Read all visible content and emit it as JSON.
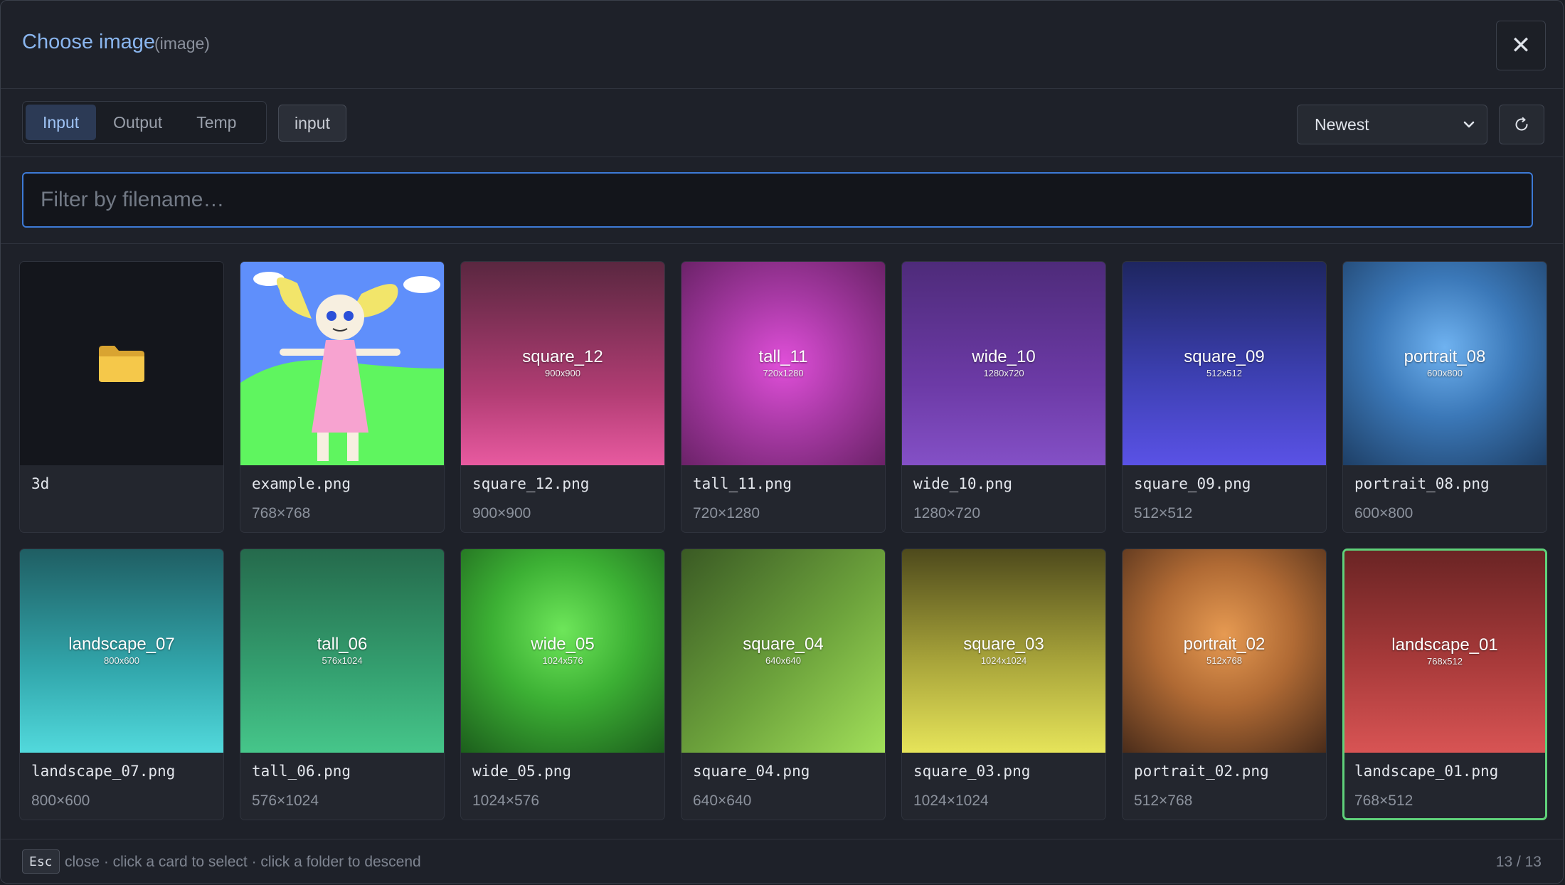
{
  "header": {
    "title": "Choose image",
    "subtitle": "(image)",
    "close_label": "✕"
  },
  "toolbar": {
    "tabs": [
      {
        "label": "Input",
        "active": true
      },
      {
        "label": "Output",
        "active": false
      },
      {
        "label": "Temp",
        "active": false
      }
    ],
    "path_chip": "input",
    "sort": {
      "value": "Newest"
    },
    "refresh_icon": "refresh-icon"
  },
  "filter": {
    "placeholder": "Filter by filename…",
    "value": ""
  },
  "items": [
    {
      "kind": "folder",
      "name": "3d",
      "dims": "",
      "thumb_label": "",
      "thumb_dims": "",
      "icon": "folder-icon"
    },
    {
      "kind": "image",
      "name": "example.png",
      "dims": "768×768",
      "thumb_label": "",
      "thumb_dims": ""
    },
    {
      "kind": "image",
      "name": "square_12.png",
      "dims": "900×900",
      "thumb_label": "square_12",
      "thumb_dims": "900x900",
      "color": "#b23d74"
    },
    {
      "kind": "image",
      "name": "tall_11.png",
      "dims": "720×1280",
      "thumb_label": "tall_11",
      "thumb_dims": "720x1280",
      "color": "#a93aa6"
    },
    {
      "kind": "image",
      "name": "wide_10.png",
      "dims": "1280×720",
      "thumb_label": "wide_10",
      "thumb_dims": "1280x720",
      "color": "#6c3aa6"
    },
    {
      "kind": "image",
      "name": "square_09.png",
      "dims": "512×512",
      "thumb_label": "square_09",
      "thumb_dims": "512x512",
      "color": "#3c3fb0"
    },
    {
      "kind": "image",
      "name": "portrait_08.png",
      "dims": "600×800",
      "thumb_label": "portrait_08",
      "thumb_dims": "600x800",
      "color": "#3b78b8"
    },
    {
      "kind": "image",
      "name": "landscape_07.png",
      "dims": "800×600",
      "thumb_label": "landscape_07",
      "thumb_dims": "800x600",
      "color": "#32a8ad"
    },
    {
      "kind": "image",
      "name": "tall_06.png",
      "dims": "576×1024",
      "thumb_label": "tall_06",
      "thumb_dims": "576x1024",
      "color": "#34a070"
    },
    {
      "kind": "image",
      "name": "wide_05.png",
      "dims": "1024×576",
      "thumb_label": "wide_05",
      "thumb_dims": "1024x576",
      "color": "#3cb034"
    },
    {
      "kind": "image",
      "name": "square_04.png",
      "dims": "640×640",
      "thumb_label": "square_04",
      "thumb_dims": "640x640",
      "color": "#6da33c"
    },
    {
      "kind": "image",
      "name": "square_03.png",
      "dims": "1024×1024",
      "thumb_label": "square_03",
      "thumb_dims": "1024x1024",
      "color": "#a8a43a"
    },
    {
      "kind": "image",
      "name": "portrait_02.png",
      "dims": "512×768",
      "thumb_label": "portrait_02",
      "thumb_dims": "512x768",
      "color": "#b06a34"
    },
    {
      "kind": "image",
      "name": "landscape_01.png",
      "dims": "768×512",
      "thumb_label": "landscape_01",
      "thumb_dims": "768x512",
      "color": "#a83a3a",
      "selected": true
    }
  ],
  "footer": {
    "key": "Esc",
    "hint": "close · click a card to select · click a folder to descend",
    "count": "13 / 13"
  },
  "colors": {
    "accent": "#3d7ad6",
    "selected_border": "#5fd17a",
    "title": "#8ab6ef"
  }
}
